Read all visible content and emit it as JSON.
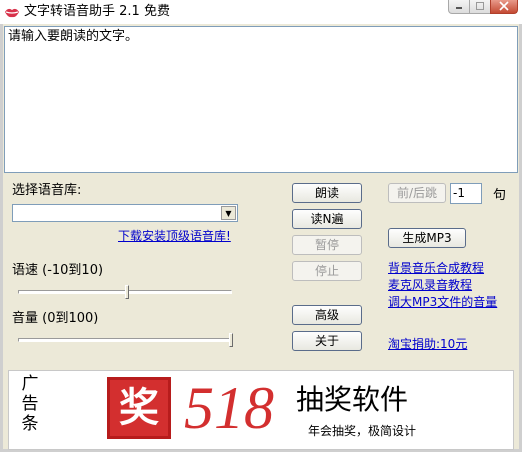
{
  "window": {
    "title": "文字转语音助手 2.1 免费",
    "icon": "lips-icon",
    "controls": [
      "minimize-icon",
      "maximize-icon",
      "close-icon"
    ]
  },
  "main": {
    "text_value": "请输入要朗读的文字。"
  },
  "voice": {
    "label": "选择语音库:",
    "selected": "",
    "download_link": "下载安装顶级语音库!"
  },
  "speed": {
    "label": "语速 (-10到10)",
    "value": 0
  },
  "volume": {
    "label": "音量 (0到100)",
    "value": 100
  },
  "buttons": {
    "read": "朗读",
    "read_n": "读N遍",
    "pause": "暂停",
    "stop": "停止",
    "advanced": "高级",
    "about": "关于",
    "prev_next": "前/后跳",
    "make_mp3": "生成MP3"
  },
  "jump": {
    "value": "-1",
    "unit": "句"
  },
  "links": {
    "bgm": "背景音乐合成教程",
    "mic": "麦克风录音教程",
    "mp3_volume": "调大MP3文件的音量",
    "donate": "淘宝捐助:10元"
  },
  "ad": {
    "side_label": [
      "广",
      "告",
      "条"
    ],
    "logo_char": "奖",
    "number": "518",
    "name": "抽奖软件",
    "slogan": "年会抽奖，极简设计"
  },
  "colors": {
    "link": "#0000cc",
    "ad_red": "#d32f2f",
    "dialog_bg": "#ece9d8"
  }
}
